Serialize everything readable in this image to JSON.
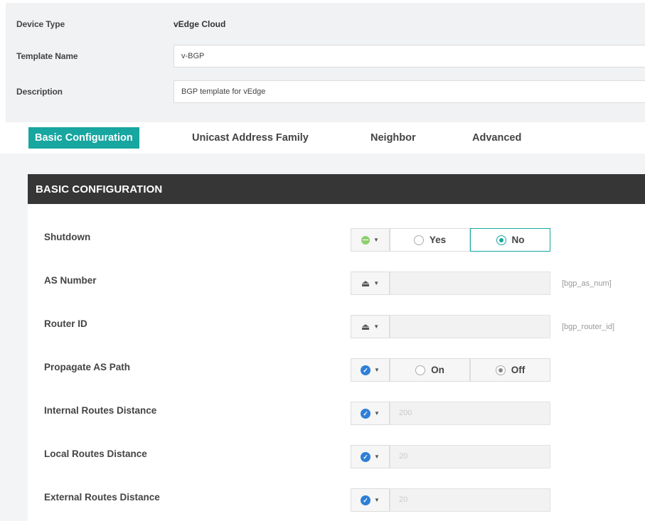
{
  "header": {
    "device_type_label": "Device Type",
    "device_type_value": "vEdge Cloud",
    "template_name_label": "Template Name",
    "template_name_value": "v-BGP",
    "description_label": "Description",
    "description_value": "BGP template for vEdge"
  },
  "tabs": [
    {
      "label": "Basic Configuration",
      "active": true
    },
    {
      "label": "Unicast Address Family",
      "active": false
    },
    {
      "label": "Neighbor",
      "active": false
    },
    {
      "label": "Advanced",
      "active": false
    }
  ],
  "panel": {
    "title": "BASIC CONFIGURATION",
    "fields": [
      {
        "label": "Shutdown",
        "scope_icon": "globe-icon",
        "options": [
          "Yes",
          "No"
        ],
        "selected": "No"
      },
      {
        "label": "AS Number",
        "scope_icon": "device-icon",
        "value": "",
        "variable": "[bgp_as_num]"
      },
      {
        "label": "Router ID",
        "scope_icon": "device-icon",
        "value": "",
        "variable": "[bgp_router_id]"
      },
      {
        "label": "Propagate AS Path",
        "scope_icon": "check-icon",
        "options": [
          "On",
          "Off"
        ],
        "selected": "Off"
      },
      {
        "label": "Internal Routes Distance",
        "scope_icon": "check-icon",
        "value": "200"
      },
      {
        "label": "Local Routes Distance",
        "scope_icon": "check-icon",
        "value": "20"
      },
      {
        "label": "External Routes Distance",
        "scope_icon": "check-icon",
        "value": "20"
      }
    ]
  },
  "colors": {
    "accent": "#17a6a0",
    "panel_header": "#363636",
    "check_blue": "#2f7fd6",
    "globe_green": "#8ccf6e"
  }
}
